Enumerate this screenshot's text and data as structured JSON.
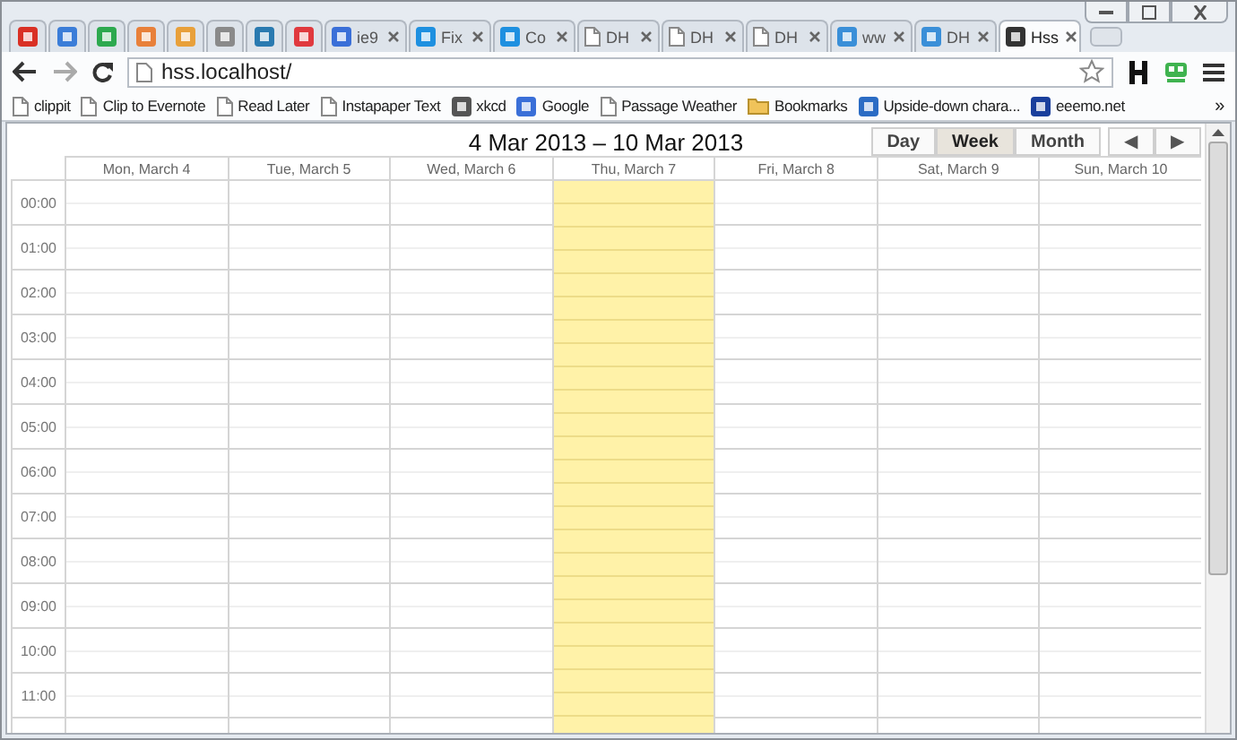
{
  "tabs": [
    {
      "kind": "pinned",
      "color": "#d93025",
      "selected": false
    },
    {
      "kind": "pinned",
      "color": "#3b7dd8",
      "selected": false
    },
    {
      "kind": "pinned",
      "color": "#2da94f",
      "selected": false
    },
    {
      "kind": "pinned",
      "color": "#e8803a",
      "selected": false
    },
    {
      "kind": "pinned",
      "color": "#e8a03a",
      "selected": false
    },
    {
      "kind": "pinned",
      "color": "#8a8a8a",
      "selected": false
    },
    {
      "kind": "pinned",
      "color": "#2a7ab0",
      "selected": false
    },
    {
      "kind": "pinned",
      "color": "#e0393e",
      "selected": false
    },
    {
      "kind": "normal",
      "label": "ie9",
      "color": "#3a6fd8",
      "selected": false
    },
    {
      "kind": "normal",
      "label": "Fix",
      "color": "#1e90e0",
      "selected": false
    },
    {
      "kind": "normal",
      "label": "Co",
      "color": "#1e90e0",
      "selected": false
    },
    {
      "kind": "normal",
      "label": "DH",
      "selected": false
    },
    {
      "kind": "normal",
      "label": "DH",
      "selected": false
    },
    {
      "kind": "normal",
      "label": "DH",
      "selected": false
    },
    {
      "kind": "normal",
      "label": "ww",
      "color": "#3a8fd8",
      "selected": false
    },
    {
      "kind": "normal",
      "label": "DH",
      "color": "#3a8fd8",
      "selected": false
    },
    {
      "kind": "normal",
      "label": "Hss",
      "color": "#333333",
      "selected": true
    }
  ],
  "address_bar": {
    "url": "hss.localhost/"
  },
  "bookmarks": [
    {
      "label": "clippit",
      "kind": "page"
    },
    {
      "label": "Clip to Evernote",
      "kind": "page"
    },
    {
      "label": "Read Later",
      "kind": "page"
    },
    {
      "label": "Instapaper Text",
      "kind": "page"
    },
    {
      "label": "xkcd",
      "kind": "site",
      "color": "#555555"
    },
    {
      "label": "Google",
      "kind": "site",
      "color": "#3a6fd8"
    },
    {
      "label": "Passage Weather",
      "kind": "page"
    },
    {
      "label": "Bookmarks",
      "kind": "folder"
    },
    {
      "label": "Upside-down chara...",
      "kind": "site",
      "color": "#2b6cc4"
    },
    {
      "label": "eeemo.net",
      "kind": "site",
      "color": "#1a3f9c"
    }
  ],
  "bookmarks_overflow": "»",
  "calendar": {
    "title": "4 Mar 2013 – 10 Mar 2013",
    "views": [
      {
        "label": "Day",
        "selected": false
      },
      {
        "label": "Week",
        "selected": true
      },
      {
        "label": "Month",
        "selected": false
      }
    ],
    "nav": [
      "◀",
      "▶"
    ],
    "days": [
      {
        "label": "Mon, March 4",
        "today": false
      },
      {
        "label": "Tue, March 5",
        "today": false
      },
      {
        "label": "Wed, March 6",
        "today": false
      },
      {
        "label": "Thu, March 7",
        "today": true
      },
      {
        "label": "Fri, March 8",
        "today": false
      },
      {
        "label": "Sat, March 9",
        "today": false
      },
      {
        "label": "Sun, March 10",
        "today": false
      }
    ],
    "hours": [
      "00:00",
      "01:00",
      "02:00",
      "03:00",
      "04:00",
      "05:00",
      "06:00",
      "07:00",
      "08:00",
      "09:00",
      "10:00",
      "11:00"
    ]
  }
}
